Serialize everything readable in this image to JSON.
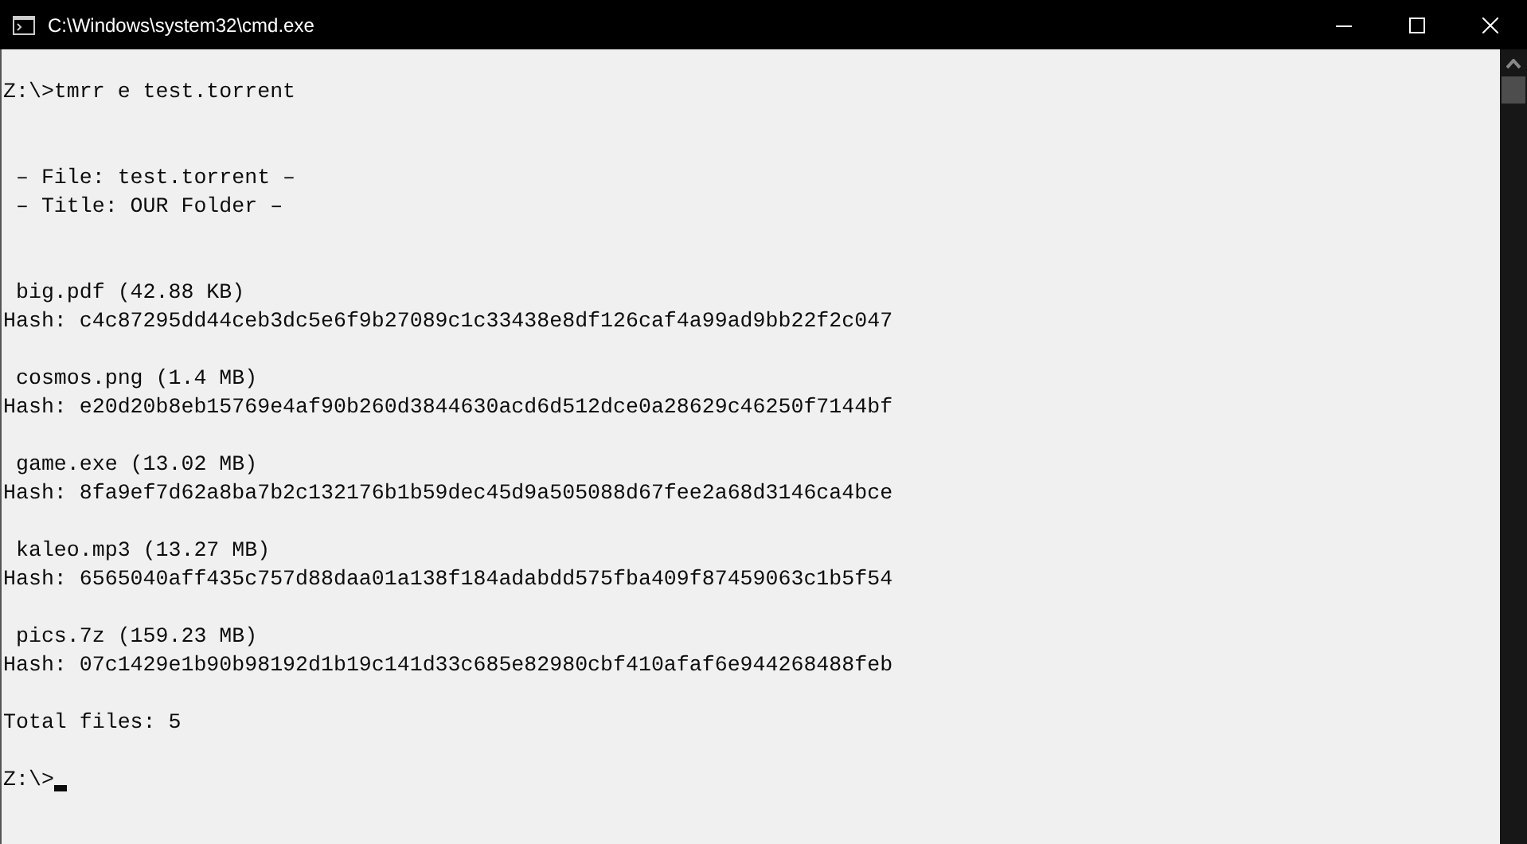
{
  "window": {
    "title": "C:\\Windows\\system32\\cmd.exe"
  },
  "console": {
    "command": "Z:\\>tmrr e test.torrent",
    "header": [
      " – File: test.torrent –",
      " – Title: OUR Folder –"
    ],
    "files": [
      {
        "name": " big.pdf (42.88 KB)",
        "hash": "Hash: c4c87295dd44ceb3dc5e6f9b27089c1c33438e8df126caf4a99ad9bb22f2c047"
      },
      {
        "name": " cosmos.png (1.4 MB)",
        "hash": "Hash: e20d20b8eb15769e4af90b260d3844630acd6d512dce0a28629c46250f7144bf"
      },
      {
        "name": " game.exe (13.02 MB)",
        "hash": "Hash: 8fa9ef7d62a8ba7b2c132176b1b59dec45d9a505088d67fee2a68d3146ca4bce"
      },
      {
        "name": " kaleo.mp3 (13.27 MB)",
        "hash": "Hash: 6565040aff435c757d88daa01a138f184adabdd575fba409f87459063c1b5f54"
      },
      {
        "name": " pics.7z (159.23 MB)",
        "hash": "Hash: 07c1429e1b90b98192d1b19c141d33c685e82980cbf410afaf6e944268488feb"
      }
    ],
    "total": "Total files: 5",
    "prompt": {
      "text": "Z:\\>",
      "cursor": true
    }
  }
}
